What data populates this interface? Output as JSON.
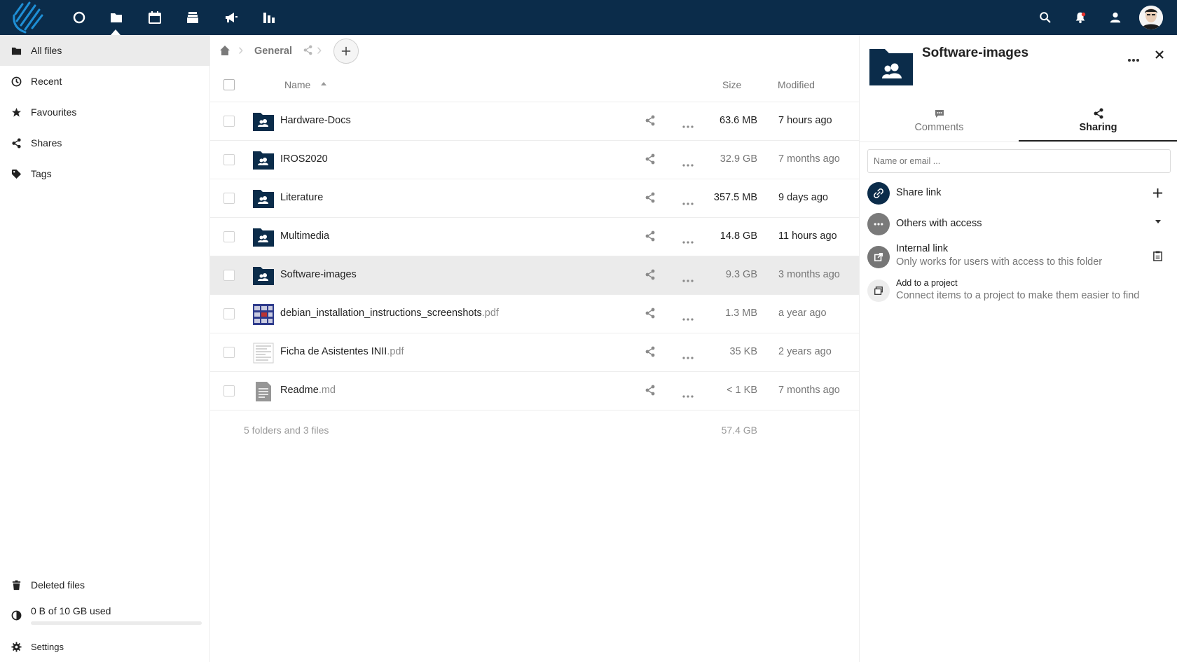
{
  "header": {
    "apps": [
      "dashboard-icon",
      "files-icon",
      "calendar-icon",
      "deck-icon",
      "announcements-icon",
      "activity-icon"
    ],
    "right_icons": [
      "search-icon",
      "notifications-icon",
      "contacts-icon",
      "user-avatar"
    ]
  },
  "navigation": {
    "items": [
      {
        "label": "All files",
        "icon": "folder-icon"
      },
      {
        "label": "Recent",
        "icon": "clock-icon"
      },
      {
        "label": "Favourites",
        "icon": "star-icon"
      },
      {
        "label": "Shares",
        "icon": "share-icon"
      },
      {
        "label": "Tags",
        "icon": "tag-icon"
      }
    ],
    "deleted_label": "Deleted files",
    "quota_label": "0 B of 10 GB used",
    "quota_fraction": 0,
    "settings_label": "Settings"
  },
  "breadcrumb": {
    "current": "General"
  },
  "table": {
    "col_name": "Name",
    "col_size": "Size",
    "col_modified": "Modified",
    "rows": [
      {
        "name": "Hardware-Docs",
        "ext": "",
        "type": "shared-folder",
        "size": "63.6 MB",
        "modified": "7 hours ago",
        "selected": false,
        "recent": true
      },
      {
        "name": "IROS2020",
        "ext": "",
        "type": "shared-folder",
        "size": "32.9 GB",
        "modified": "7 months ago",
        "selected": false,
        "recent": false
      },
      {
        "name": "Literature",
        "ext": "",
        "type": "shared-folder",
        "size": "357.5 MB",
        "modified": "9 days ago",
        "selected": false,
        "recent": true
      },
      {
        "name": "Multimedia",
        "ext": "",
        "type": "shared-folder",
        "size": "14.8 GB",
        "modified": "11 hours ago",
        "selected": false,
        "recent": true
      },
      {
        "name": "Software-images",
        "ext": "",
        "type": "shared-folder",
        "size": "9.3 GB",
        "modified": "3 months ago",
        "selected": true,
        "recent": false
      },
      {
        "name": "debian_installation_instructions_screenshots",
        "ext": ".pdf",
        "type": "pdf-screenshot",
        "size": "1.3 MB",
        "modified": "a year ago",
        "selected": false,
        "recent": false
      },
      {
        "name": "Ficha de Asistentes INII",
        "ext": ".pdf",
        "type": "pdf-document",
        "size": "35 KB",
        "modified": "2 years ago",
        "selected": false,
        "recent": false
      },
      {
        "name": "Readme",
        "ext": ".md",
        "type": "text-file",
        "size": "< 1 KB",
        "modified": "7 months ago",
        "selected": false,
        "recent": false
      }
    ],
    "summary_count": "5 folders and 3 files",
    "summary_size": "57.4 GB"
  },
  "sidebar": {
    "title": "Software-images",
    "tabs": [
      {
        "label": "Comments",
        "icon": "comment-icon"
      },
      {
        "label": "Sharing",
        "icon": "share-icon"
      }
    ],
    "sharee_placeholder": "Name or email ...",
    "share_link_label": "Share link",
    "others_label": "Others with access",
    "internal_title": "Internal link",
    "internal_sub": "Only works for users with access to this folder",
    "project_title": "Add to a project",
    "project_sub": "Connect items to a project to make them easier to find"
  },
  "colors": {
    "header_bg": "#0b2c4a",
    "brand_blue": "#0082c9",
    "folder_dark": "#0b2c4a",
    "selected_row": "#ebebeb"
  }
}
